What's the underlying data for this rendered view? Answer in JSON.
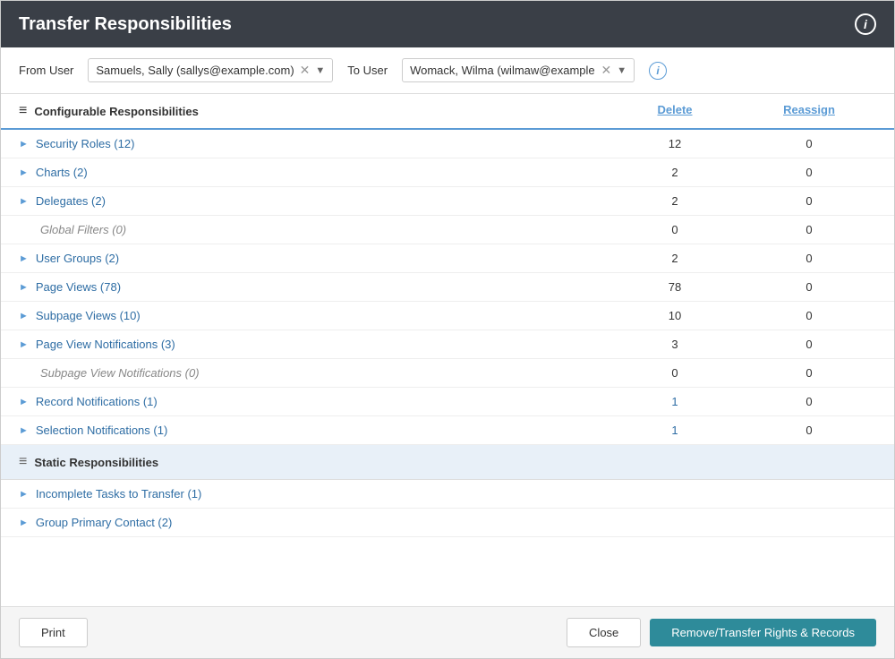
{
  "title": "Transfer Responsibilities",
  "info_icon_label": "i",
  "from_user": {
    "label": "From User",
    "value": "Samuels, Sally (sallys@example.com)"
  },
  "to_user": {
    "label": "To User",
    "value": "Womack, Wilma (wilmaw@example"
  },
  "configurable_section": {
    "title": "Configurable Responsibilities",
    "delete_label": "Delete",
    "reassign_label": "Reassign"
  },
  "configurable_rows": [
    {
      "label": "Security Roles (12)",
      "delete": "12",
      "reassign": "0",
      "expandable": true,
      "disabled": false,
      "highlight_delete": false
    },
    {
      "label": "Charts (2)",
      "delete": "2",
      "reassign": "0",
      "expandable": true,
      "disabled": false,
      "highlight_delete": false
    },
    {
      "label": "Delegates (2)",
      "delete": "2",
      "reassign": "0",
      "expandable": true,
      "disabled": false,
      "highlight_delete": false
    },
    {
      "label": "Global Filters (0)",
      "delete": "0",
      "reassign": "0",
      "expandable": false,
      "disabled": true,
      "highlight_delete": false
    },
    {
      "label": "User Groups (2)",
      "delete": "2",
      "reassign": "0",
      "expandable": true,
      "disabled": false,
      "highlight_delete": false
    },
    {
      "label": "Page Views (78)",
      "delete": "78",
      "reassign": "0",
      "expandable": true,
      "disabled": false,
      "highlight_delete": false
    },
    {
      "label": "Subpage Views (10)",
      "delete": "10",
      "reassign": "0",
      "expandable": true,
      "disabled": false,
      "highlight_delete": false
    },
    {
      "label": "Page View Notifications (3)",
      "delete": "3",
      "reassign": "0",
      "expandable": true,
      "disabled": false,
      "highlight_delete": false
    },
    {
      "label": "Subpage View Notifications (0)",
      "delete": "0",
      "reassign": "0",
      "expandable": false,
      "disabled": true,
      "highlight_delete": false
    },
    {
      "label": "Record Notifications (1)",
      "delete": "1",
      "reassign": "0",
      "expandable": true,
      "disabled": false,
      "highlight_delete": true
    },
    {
      "label": "Selection Notifications (1)",
      "delete": "1",
      "reassign": "0",
      "expandable": true,
      "disabled": false,
      "highlight_delete": true
    }
  ],
  "static_section": {
    "title": "Static Responsibilities"
  },
  "static_rows": [
    {
      "label": "Incomplete Tasks to Transfer (1)",
      "expandable": true
    },
    {
      "label": "Group Primary Contact (2)",
      "expandable": true
    }
  ],
  "footer": {
    "print_label": "Print",
    "close_label": "Close",
    "transfer_label": "Remove/Transfer Rights & Records"
  }
}
